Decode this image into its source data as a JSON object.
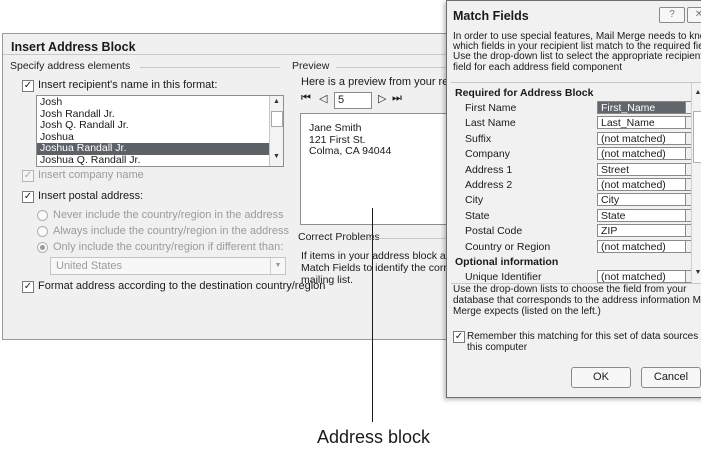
{
  "insert_dialog": {
    "title": "Insert Address Block",
    "specify_label": "Specify address elements",
    "insert_name_label": "Insert recipient's name in this format:",
    "name_formats": [
      "Josh",
      "Josh Randall Jr.",
      "Josh Q. Randall Jr.",
      "Joshua",
      "Joshua Randall Jr.",
      "Joshua Q. Randall Jr."
    ],
    "selected_index": 4,
    "insert_company_label": "Insert company name",
    "insert_postal_label": "Insert postal address:",
    "radio_never": "Never include the country/region in the address",
    "radio_always": "Always include the country/region in the address",
    "radio_only": "Only include the country/region if different than:",
    "country_value": "United States",
    "format_label": "Format address according to the destination country/region",
    "preview_label": "Preview",
    "preview_intro": "Here is a preview from your recipie",
    "record_number": "5",
    "nav_first": "⏮",
    "nav_prev": "◁",
    "nav_next": "▷",
    "nav_last": "⏭",
    "address_lines": [
      "Jane Smith",
      "121 First St.",
      "Colma, CA 94044"
    ],
    "correct_label": "Correct Problems",
    "correct_text": [
      "If items in your address block are r",
      "Match Fields to identify the correct",
      "mailing list."
    ]
  },
  "match_dialog": {
    "title": "Match Fields",
    "intro": [
      "In order to use special features, Mail Merge needs to know",
      "which fields in your recipient list match to the required fields.",
      "Use the drop-down list to select the appropriate recipient list",
      "field for each address field component"
    ],
    "required_header": "Required for Address Block",
    "fields": [
      {
        "name": "First Name",
        "value": "First_Name"
      },
      {
        "name": "Last Name",
        "value": "Last_Name"
      },
      {
        "name": "Suffix",
        "value": "(not matched)"
      },
      {
        "name": "Company",
        "value": "(not matched)"
      },
      {
        "name": "Address 1",
        "value": "Street"
      },
      {
        "name": "Address 2",
        "value": "(not matched)"
      },
      {
        "name": "City",
        "value": "City"
      },
      {
        "name": "State",
        "value": "State"
      },
      {
        "name": "Postal Code",
        "value": "ZIP"
      },
      {
        "name": "Country or Region",
        "value": "(not matched)"
      }
    ],
    "optional_header": "Optional information",
    "optional_fields": [
      {
        "name": "Unique Identifier",
        "value": "(not matched)"
      }
    ],
    "footer_text": [
      "Use the drop-down lists to choose the field from your",
      "database that corresponds to the address information Mail",
      "Merge expects (listed on the left.)"
    ],
    "remember_label": [
      "Remember this matching for this set of data sources on",
      "this computer"
    ],
    "ok_label": "OK",
    "cancel_label": "Cancel",
    "help_glyph": "?",
    "close_glyph": "✕"
  },
  "callout_label": "Address block"
}
